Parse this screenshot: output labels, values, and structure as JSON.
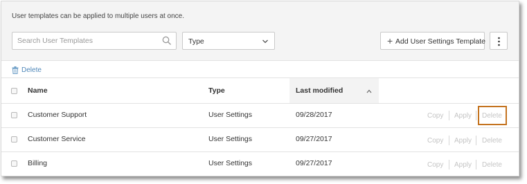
{
  "intro_text": "User templates can be applied to multiple users at once.",
  "search": {
    "placeholder": "Search User Templates"
  },
  "type_filter": {
    "value": "Type"
  },
  "add_button": {
    "label": "Add User Settings Template"
  },
  "bulk_delete": {
    "label": "Delete"
  },
  "table": {
    "columns": {
      "name": "Name",
      "type": "Type",
      "modified": "Last modified"
    },
    "sort": {
      "column": "Last modified",
      "direction": "ascending"
    },
    "rows": [
      {
        "name": "Customer Support",
        "type": "User Settings",
        "modified": "09/28/2017"
      },
      {
        "name": "Customer Service",
        "type": "User Settings",
        "modified": "09/27/2017"
      },
      {
        "name": "Billing",
        "type": "User Settings",
        "modified": "09/27/2017"
      }
    ],
    "actions": {
      "copy": "Copy",
      "apply": "Apply",
      "delete": "Delete"
    }
  },
  "colors": {
    "link": "#4d86b8",
    "highlight": "#c4731f",
    "disabled": "#c4c4c4"
  }
}
